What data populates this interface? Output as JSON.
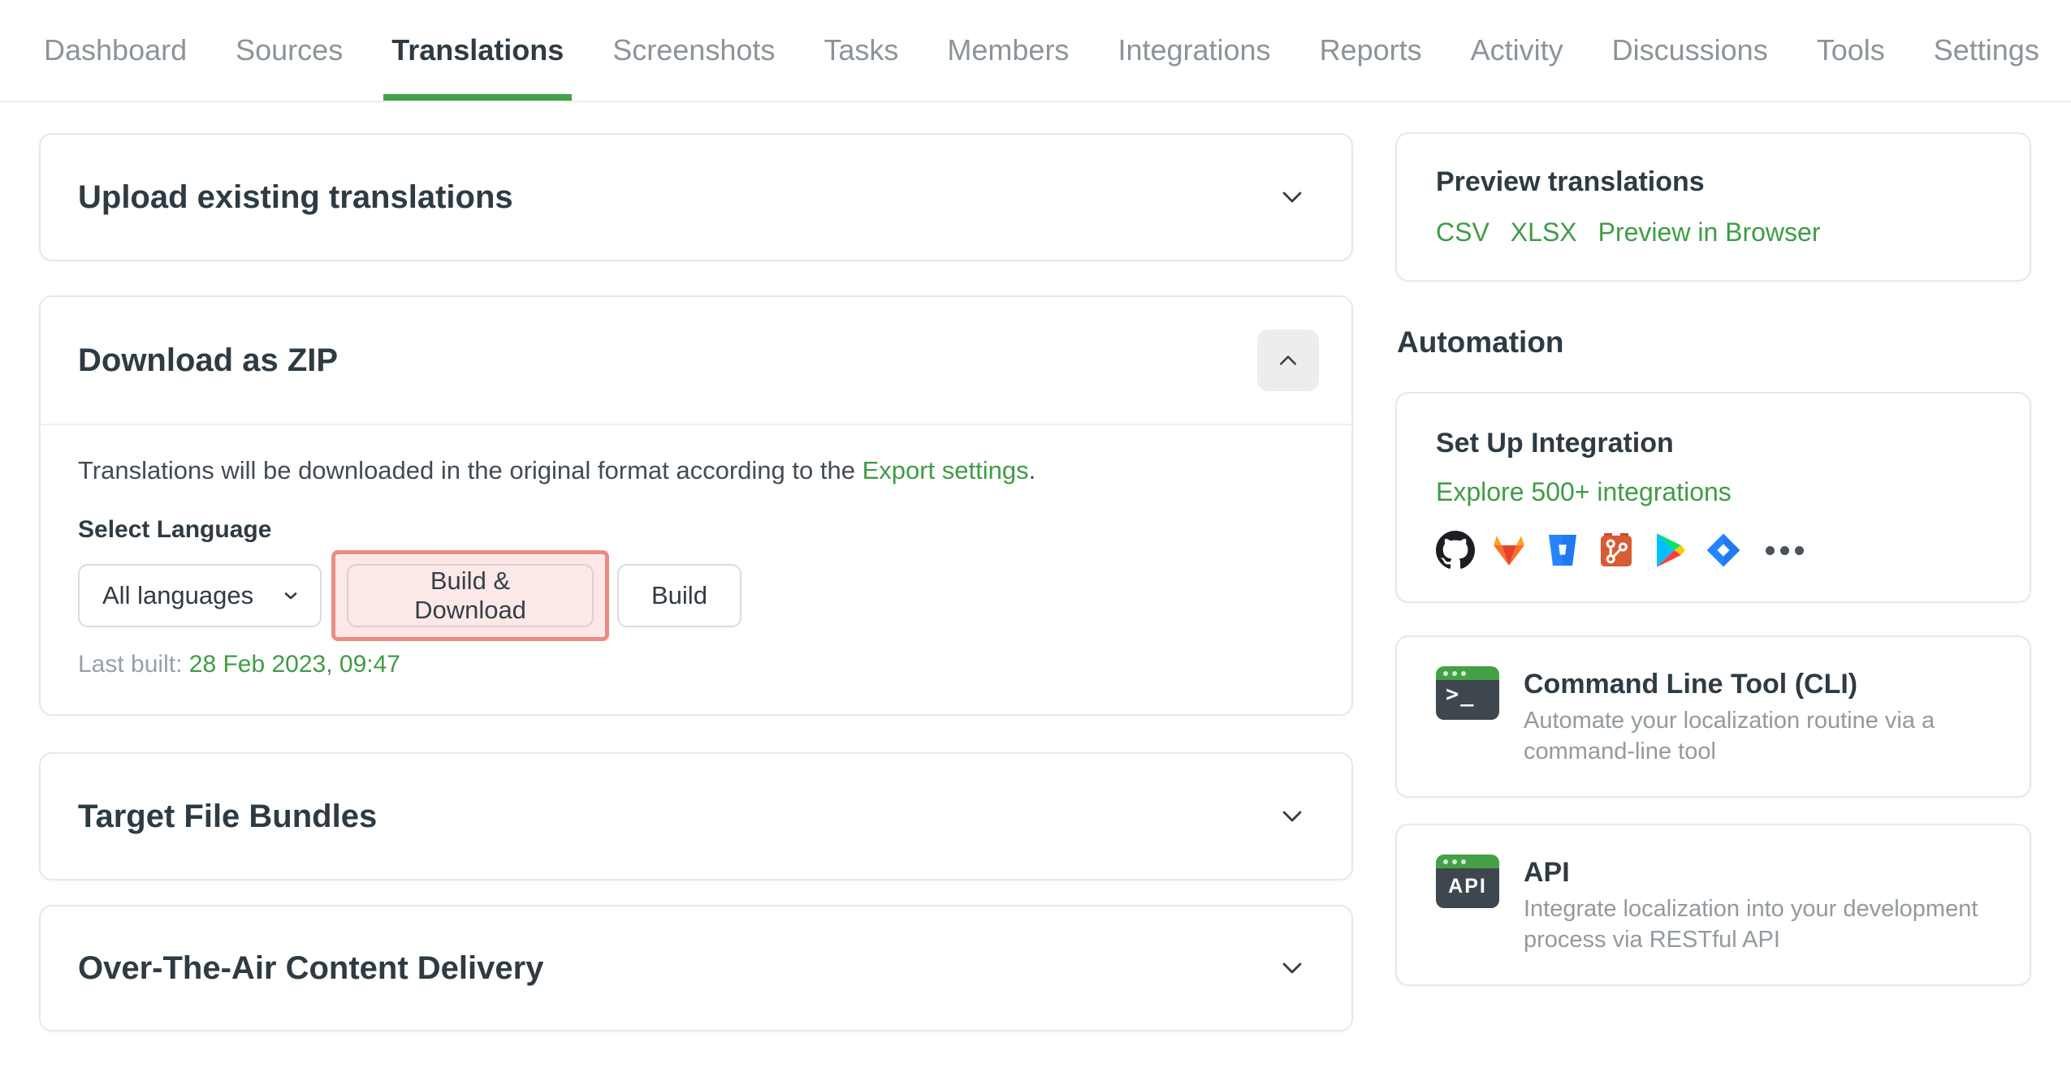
{
  "nav": {
    "items": [
      {
        "label": "Dashboard",
        "active": false
      },
      {
        "label": "Sources",
        "active": false
      },
      {
        "label": "Translations",
        "active": true
      },
      {
        "label": "Screenshots",
        "active": false
      },
      {
        "label": "Tasks",
        "active": false
      },
      {
        "label": "Members",
        "active": false
      },
      {
        "label": "Integrations",
        "active": false
      },
      {
        "label": "Reports",
        "active": false
      },
      {
        "label": "Activity",
        "active": false
      },
      {
        "label": "Discussions",
        "active": false
      },
      {
        "label": "Tools",
        "active": false
      },
      {
        "label": "Settings",
        "active": false
      }
    ]
  },
  "panels": {
    "upload": {
      "title": "Upload existing translations"
    },
    "download": {
      "title": "Download as ZIP",
      "description_prefix": "Translations will be downloaded in the original format according to the ",
      "description_link": "Export settings",
      "description_suffix": ".",
      "select_label": "Select Language",
      "language_value": "All languages",
      "build_download_label": "Build & Download",
      "build_label": "Build",
      "last_built_label": "Last built:",
      "last_built_value": "28 Feb 2023, 09:47"
    },
    "bundles": {
      "title": "Target File Bundles"
    },
    "ota": {
      "title": "Over-The-Air Content Delivery"
    }
  },
  "sidebar": {
    "preview": {
      "title": "Preview translations",
      "links": [
        {
          "label": "CSV"
        },
        {
          "label": "XLSX"
        },
        {
          "label": "Preview in Browser"
        }
      ]
    },
    "automation_heading": "Automation",
    "integration": {
      "title": "Set Up Integration",
      "link_label": "Explore 500+ integrations",
      "icons": [
        "github-icon",
        "gitlab-icon",
        "bitbucket-icon",
        "git-icon",
        "google-play-icon",
        "jira-icon",
        "more-integrations-icon"
      ]
    },
    "cli": {
      "title": "Command Line Tool (CLI)",
      "description": "Automate your localization routine via a command-line tool",
      "icon_label": ">_"
    },
    "api": {
      "title": "API",
      "description": "Integrate localization into your development process via RESTful API",
      "icon_label": "API"
    }
  },
  "colors": {
    "accent_green": "#43a047",
    "link_green": "#3f9c45",
    "highlight_border": "#e98c83",
    "highlight_background": "#fce9e7"
  }
}
